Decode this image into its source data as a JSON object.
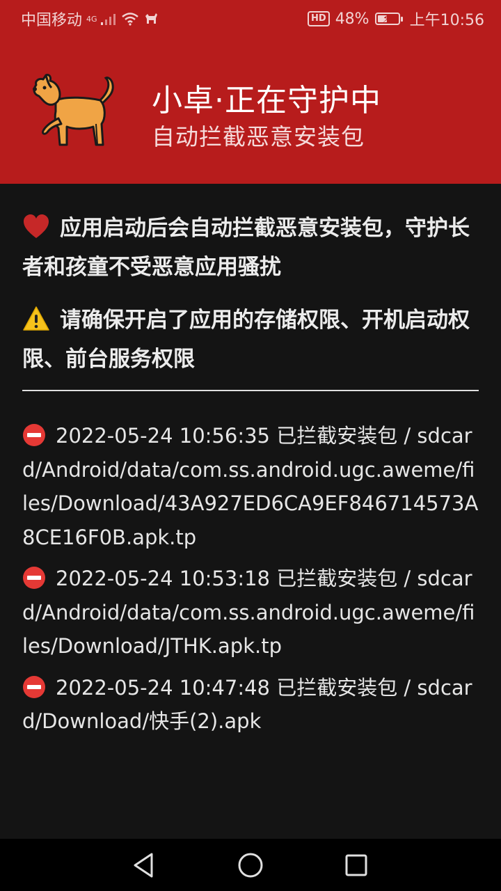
{
  "status_bar": {
    "carrier": "中国移动",
    "network": "4G",
    "hd_badge": "HD",
    "battery_level": "48%",
    "battery_fraction": 0.48,
    "time": "上午10:56"
  },
  "header": {
    "title": "小卓·正在守护中",
    "subtitle": "自动拦截恶意安装包",
    "icon": "dog-icon"
  },
  "notices": [
    {
      "icon": "heart-icon",
      "text": "应用启动后会自动拦截恶意安装包，守护长者和孩童不受恶意应用骚扰"
    },
    {
      "icon": "warning-icon",
      "text": "请确保开启了应用的存储权限、开机启动权限、前台服务权限"
    }
  ],
  "log": [
    {
      "icon": "no-entry-icon",
      "text": "2022-05-24 10:56:35 已拦截安装包 / sdcard/Android/data/com.ss.android.ugc.aweme/files/Download/43A927ED6CA9EF846714573A8CE16F0B.apk.tp"
    },
    {
      "icon": "no-entry-icon",
      "text": "2022-05-24 10:53:18 已拦截安装包 / sdcard/Android/data/com.ss.android.ugc.aweme/files/Download/JTHK.apk.tp"
    },
    {
      "icon": "no-entry-icon",
      "text": "2022-05-24 10:47:48 已拦截安装包 / sdcard/Download/快手(2).apk"
    }
  ],
  "colors": {
    "header_bg": "#b71c1c",
    "body_bg": "#141414",
    "text": "#ececec"
  }
}
